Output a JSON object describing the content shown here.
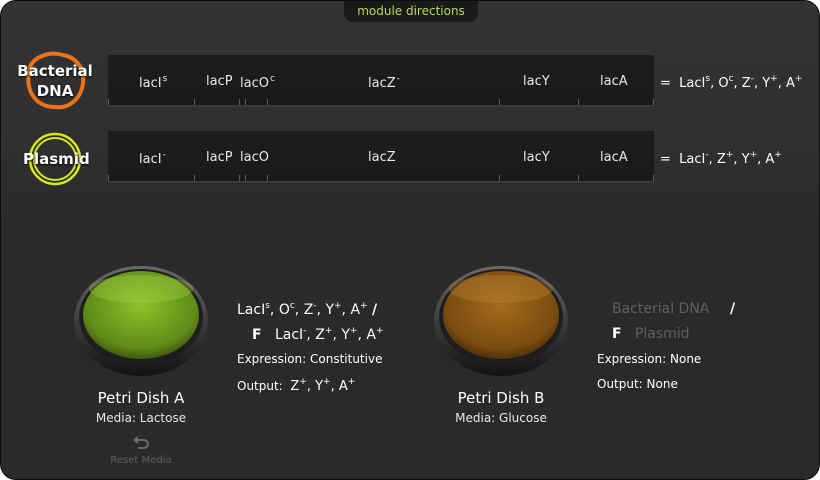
{
  "tab": {
    "label": "module directions"
  },
  "rows": [
    {
      "badge": "Bacterial DNA",
      "badge_line1": "Bacterial",
      "badge_line2": "DNA",
      "genes": [
        {
          "base": "lacI",
          "sup": "s"
        },
        {
          "base": "lacP",
          "sup": ""
        },
        {
          "base": "lacO",
          "sup": "c"
        },
        {
          "base": "lacZ",
          "sup": "-"
        },
        {
          "base": "lacY",
          "sup": ""
        },
        {
          "base": "lacA",
          "sup": ""
        }
      ],
      "result_prefix": "=",
      "result_a": "LacI",
      "result_a_sup": "s",
      "result_b": ", O",
      "result_b_sup": "c",
      "result_c": ", Z",
      "result_c_sup": "-",
      "result_d": ", Y",
      "result_d_sup": "+",
      "result_e": ", A",
      "result_e_sup": "+"
    },
    {
      "badge": "Plasmid",
      "genes": [
        {
          "base": "lacI",
          "sup": "-"
        },
        {
          "base": "lacP",
          "sup": ""
        },
        {
          "base": "lacO",
          "sup": ""
        },
        {
          "base": "lacZ",
          "sup": ""
        },
        {
          "base": "lacY",
          "sup": ""
        },
        {
          "base": "lacA",
          "sup": ""
        }
      ],
      "result_prefix": "=",
      "result_a": "LacI",
      "result_a_sup": "-",
      "result_b": ", Z",
      "result_b_sup": "+",
      "result_c": ", Y",
      "result_c_sup": "+",
      "result_d": ", A",
      "result_d_sup": "+"
    }
  ],
  "colors": {
    "accent": "#b7d957",
    "bacterial_badge": "#e8731a",
    "plasmid_badge": "#d6e81c",
    "dish_a": "#6f9a1f",
    "dish_b": "#8a5a14"
  },
  "dish_a": {
    "name": "Petri Dish A",
    "media": "Media: Lactose",
    "line1_a": "LacI",
    "line1_a_sup": "s",
    "line1_b": ", O",
    "line1_b_sup": "c",
    "line1_c": ", Z",
    "line1_c_sup": "-",
    "line1_d": ", Y",
    "line1_d_sup": "+",
    "line1_e": ", A",
    "line1_e_sup": "+",
    "line1_slash": "/",
    "line2_f": "F",
    "line2_a": "LacI",
    "line2_a_sup": "-",
    "line2_b": ", Z",
    "line2_b_sup": "+",
    "line2_c": ", Y",
    "line2_c_sup": "+",
    "line2_d": ", A",
    "line2_d_sup": "+",
    "expression": "Expression: Constitutive",
    "output_label": "Output:",
    "output_a": "Z",
    "output_a_sup": "+",
    "output_b": ", Y",
    "output_b_sup": "+",
    "output_c": ", A",
    "output_c_sup": "+"
  },
  "dish_b": {
    "name": "Petri Dish B",
    "media": "Media: Glucose",
    "line1": "Bacterial DNA",
    "line1_slash": "/",
    "line2_f": "F",
    "line2": "Plasmid",
    "expression": "Expression: None",
    "output": "Output: None"
  },
  "reset": {
    "label": "Reset Media",
    "icon": "undo-icon"
  }
}
